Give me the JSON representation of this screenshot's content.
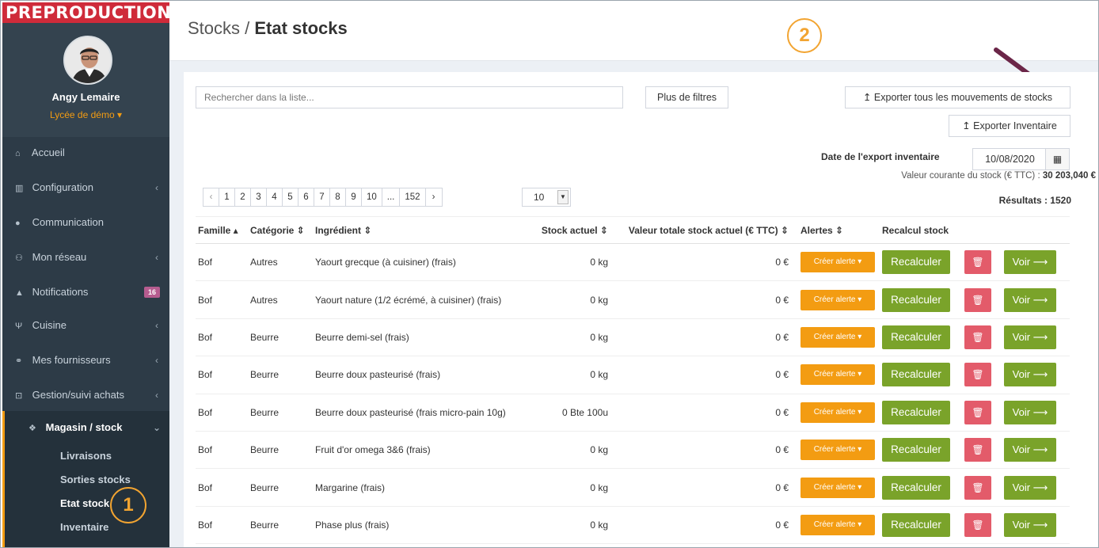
{
  "env_banner": "PREPRODUCTION",
  "user": {
    "name": "Angy Lemaire",
    "school": "Lycée de démo ▾"
  },
  "nav": {
    "items": [
      {
        "label": "Accueil",
        "icon": "home-icon"
      },
      {
        "label": "Configuration",
        "icon": "bank-icon"
      },
      {
        "label": "Communication",
        "icon": "chat-icon"
      },
      {
        "label": "Mon réseau",
        "icon": "network-icon"
      },
      {
        "label": "Notifications",
        "icon": "bell-icon",
        "badge": "16"
      },
      {
        "label": "Cuisine",
        "icon": "cutlery-icon"
      },
      {
        "label": "Mes fournisseurs",
        "icon": "handshake-icon"
      },
      {
        "label": "Gestion/suivi achats",
        "icon": "cart-icon"
      }
    ],
    "active": {
      "label": "Magasin / stock",
      "icon": "cubes-icon",
      "sub": [
        "Livraisons",
        "Sorties stocks",
        "Etat stock",
        "Inventaire"
      ]
    }
  },
  "steps": {
    "one": "1",
    "two": "2"
  },
  "breadcrumb": {
    "parent": "Stocks / ",
    "current": "Etat stocks"
  },
  "toolbar": {
    "search_placeholder": "Rechercher dans la liste...",
    "filters_label": "Plus de filtres",
    "export_movements_label": "Exporter tous les mouvements de stocks",
    "export_inventory_label": "Exporter Inventaire",
    "export_date_label": "Date de l'export inventaire",
    "export_date_value": "10/08/2020",
    "stock_value_label": "Valeur courante du stock (€ TTC) : ",
    "stock_value": "30 203,040 €",
    "results": "Résultats : 1520"
  },
  "pagination": {
    "pages": [
      "‹",
      "1",
      "2",
      "3",
      "4",
      "5",
      "6",
      "7",
      "8",
      "9",
      "10",
      "...",
      "152",
      "›"
    ],
    "page_size": "10"
  },
  "table": {
    "headers": [
      "Famille ▴",
      "Catégorie ⇕",
      "Ingrédient ⇕",
      "Stock actuel ⇕",
      "Valeur totale stock actuel (€ TTC) ⇕",
      "Alertes ⇕",
      "Recalcul stock"
    ],
    "action_labels": {
      "alert": "Créer alerte ▾",
      "recalc": "Recalculer",
      "view": "Voir ⟶"
    },
    "rows": [
      {
        "famille": "Bof",
        "categorie": "Autres",
        "ingredient": "Yaourt grecque (à cuisiner) (frais)",
        "stock": "0 kg",
        "valeur": "0 €"
      },
      {
        "famille": "Bof",
        "categorie": "Autres",
        "ingredient": "Yaourt nature (1/2 écrémé, à cuisiner) (frais)",
        "stock": "0 kg",
        "valeur": "0 €"
      },
      {
        "famille": "Bof",
        "categorie": "Beurre",
        "ingredient": "Beurre demi-sel (frais)",
        "stock": "0 kg",
        "valeur": "0 €"
      },
      {
        "famille": "Bof",
        "categorie": "Beurre",
        "ingredient": "Beurre doux pasteurisé (frais)",
        "stock": "0 kg",
        "valeur": "0 €"
      },
      {
        "famille": "Bof",
        "categorie": "Beurre",
        "ingredient": "Beurre doux pasteurisé (frais micro-pain 10g)",
        "stock": "0 Bte 100u",
        "valeur": "0 €"
      },
      {
        "famille": "Bof",
        "categorie": "Beurre",
        "ingredient": "Fruit d'or omega 3&6 (frais)",
        "stock": "0 kg",
        "valeur": "0 €"
      },
      {
        "famille": "Bof",
        "categorie": "Beurre",
        "ingredient": "Margarine (frais)",
        "stock": "0 kg",
        "valeur": "0 €"
      },
      {
        "famille": "Bof",
        "categorie": "Beurre",
        "ingredient": "Phase plus (frais)",
        "stock": "0 kg",
        "valeur": "0 €"
      }
    ]
  },
  "colors": {
    "accent": "#f39c12",
    "success": "#7aa32a",
    "danger": "#e35b6a",
    "sidebar": "#2d3b47",
    "banner": "#cf2b3a"
  }
}
